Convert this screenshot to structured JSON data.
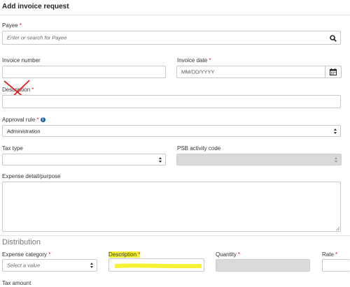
{
  "form": {
    "title": "Add invoice request",
    "payee": {
      "label": "Payee",
      "required": "*",
      "placeholder": "Enter or search for Payee"
    },
    "invoice_number": {
      "label": "Invoice number",
      "value": ""
    },
    "invoice_date": {
      "label": "Invoice date",
      "required": "*",
      "placeholder": "MM/DD/YYYY"
    },
    "description": {
      "label": "Description",
      "required": "*",
      "value": ""
    },
    "approval_rule": {
      "label": "Approval rule",
      "required": "*",
      "value": "Administration"
    },
    "tax_type": {
      "label": "Tax type",
      "value": ""
    },
    "psb_activity_code": {
      "label": "PSB activity code",
      "value": ""
    },
    "expense_detail": {
      "label": "Expense detail/purpose",
      "value": ""
    }
  },
  "distribution": {
    "heading": "Distribution",
    "expense_category": {
      "label": "Expense category",
      "required": "*",
      "placeholder": "Select a value"
    },
    "description": {
      "label": "Description",
      "required": "*"
    },
    "quantity": {
      "label": "Quantity",
      "required": "*"
    },
    "rate": {
      "label": "Rate",
      "required": "*"
    },
    "tax_amount": {
      "label": "Tax amount"
    }
  },
  "annotations": {
    "cross_color": "#e02020",
    "highlight_color": "#f6f233"
  },
  "icons": {
    "search": "search-icon",
    "calendar": "calendar-icon",
    "info": "info-icon",
    "select_arrows": "sort-arrows-icon"
  }
}
